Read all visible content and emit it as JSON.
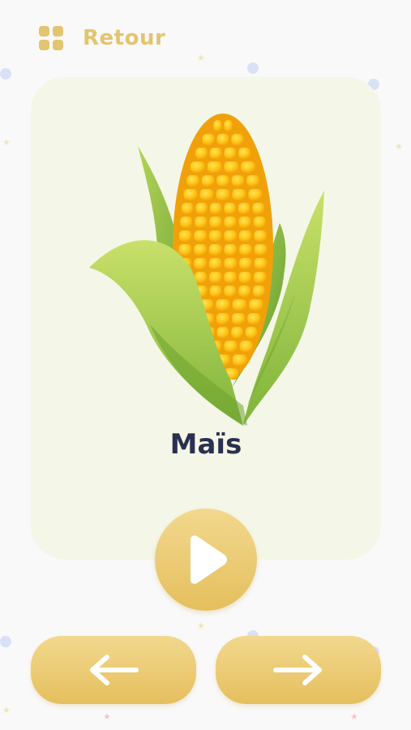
{
  "header": {
    "menu_icon": "grid-icon",
    "back_label": "Retour"
  },
  "card": {
    "image": "corn-cob",
    "word": "Maïs"
  },
  "controls": {
    "play_icon": "play-icon",
    "previous_icon": "arrow-left-icon",
    "next_icon": "arrow-right-icon"
  },
  "colors": {
    "accent": "#e3c46f",
    "card_background": "#f4f7e7",
    "title_text": "#2a3150",
    "background": "#f9f9f9"
  }
}
